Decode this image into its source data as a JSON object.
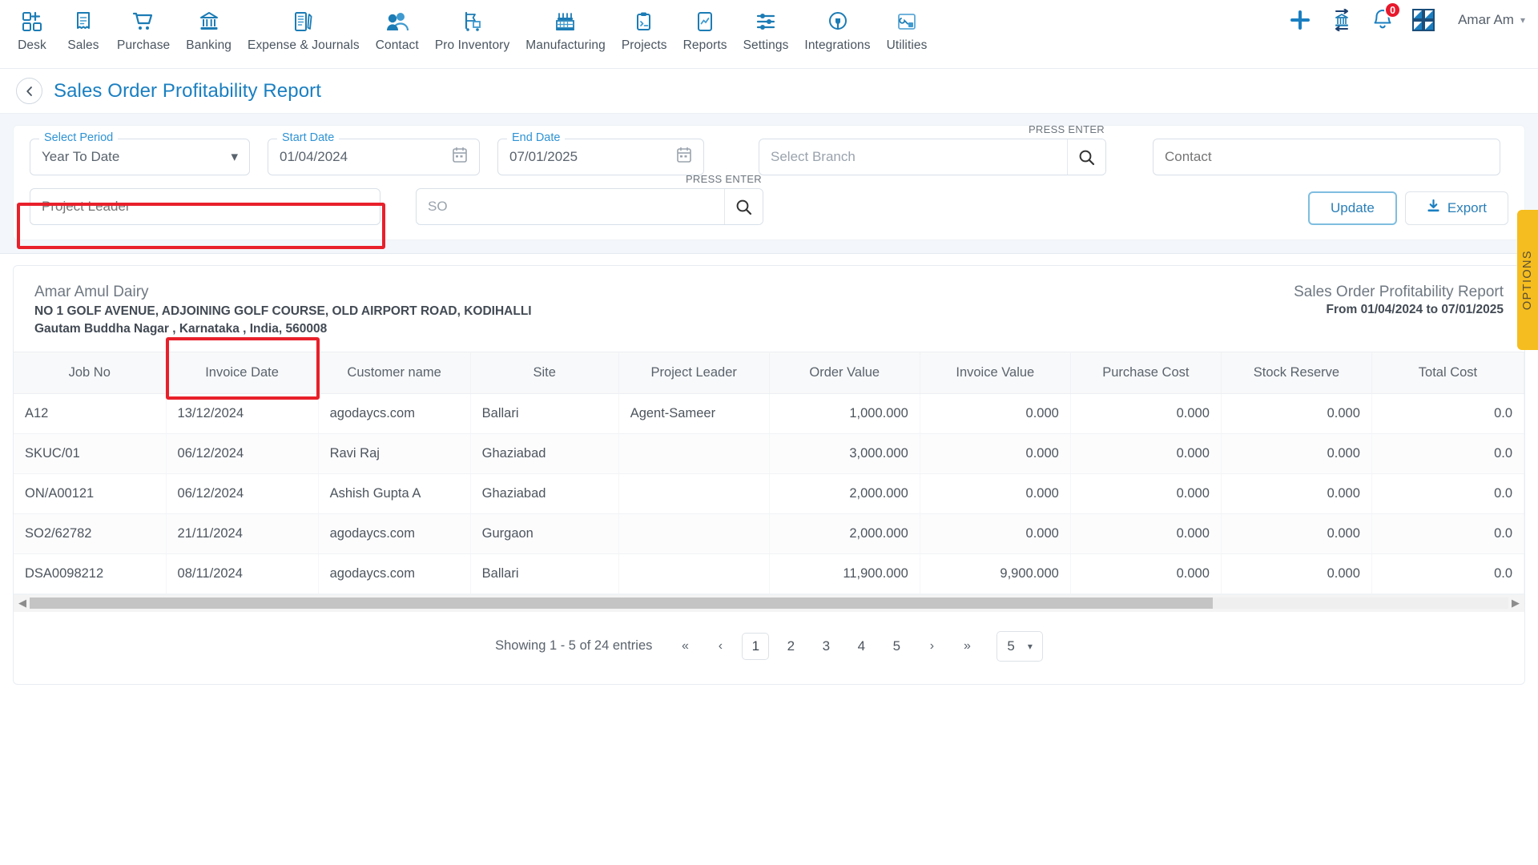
{
  "nav": {
    "items": [
      {
        "label": "Desk",
        "icon": "desk-icon"
      },
      {
        "label": "Sales",
        "icon": "sales-receipt-icon"
      },
      {
        "label": "Purchase",
        "icon": "cart-icon"
      },
      {
        "label": "Banking",
        "icon": "bank-icon"
      },
      {
        "label": "Expense & Journals",
        "icon": "journal-icon"
      },
      {
        "label": "Contact",
        "icon": "people-icon"
      },
      {
        "label": "Pro Inventory",
        "icon": "inventory-icon"
      },
      {
        "label": "Manufacturing",
        "icon": "factory-icon"
      },
      {
        "label": "Projects",
        "icon": "projects-icon"
      },
      {
        "label": "Reports",
        "icon": "reports-chart-icon"
      },
      {
        "label": "Settings",
        "icon": "sliders-icon"
      },
      {
        "label": "Integrations",
        "icon": "plug-icon"
      },
      {
        "label": "Utilities",
        "icon": "utilities-icon"
      }
    ],
    "right": {
      "add_icon": "plus-icon",
      "bank_transfer_icon": "bank-transfer-icon",
      "notification_icon": "bell-icon",
      "notification_count": "0",
      "apps_icon": "grid-apps-icon",
      "user_name": "Amar Am",
      "user_caret_icon": "chevron-down-icon"
    }
  },
  "page": {
    "back_icon": "chevron-left-icon",
    "title": "Sales Order Profitability Report"
  },
  "filters": {
    "period": {
      "legend": "Select Period",
      "value": "Year To Date",
      "caret": "chevron-down-icon"
    },
    "start_date": {
      "legend": "Start Date",
      "value": "01/04/2024",
      "icon": "calendar-icon"
    },
    "end_date": {
      "legend": "End Date",
      "value": "07/01/2025",
      "icon": "calendar-icon"
    },
    "branch": {
      "placeholder": "Select Branch",
      "hint": "PRESS ENTER",
      "icon": "search-icon"
    },
    "contact": {
      "placeholder": "Contact"
    },
    "project_leader": {
      "placeholder": "Project Leader"
    },
    "so": {
      "placeholder": "SO",
      "hint": "PRESS ENTER",
      "icon": "search-icon"
    },
    "update_label": "Update",
    "export_label": "Export",
    "export_icon": "download-icon",
    "highlight_color": "#e8202a"
  },
  "options_tab": {
    "label": "OPTIONS",
    "color": "#f5bd1f"
  },
  "report": {
    "company_name": "Amar Amul Dairy",
    "address_line1": "NO 1 GOLF AVENUE, ADJOINING GOLF COURSE, OLD AIRPORT ROAD, KODIHALLI",
    "address_line2": "Gautam Buddha Nagar , Karnataka , India, 560008",
    "title": "Sales Order Profitability Report",
    "date_range": "From 01/04/2024 to 07/01/2025",
    "columns": [
      {
        "label": "Job No",
        "align": "txt"
      },
      {
        "label": "Invoice Date",
        "align": "txt"
      },
      {
        "label": "Customer name",
        "align": "txt"
      },
      {
        "label": "Site",
        "align": "txt"
      },
      {
        "label": "Project Leader",
        "align": "txt"
      },
      {
        "label": "Order Value",
        "align": "num"
      },
      {
        "label": "Invoice Value",
        "align": "num"
      },
      {
        "label": "Purchase Cost",
        "align": "num"
      },
      {
        "label": "Stock Reserve",
        "align": "num"
      },
      {
        "label": "Total Cost",
        "align": "num"
      }
    ],
    "rows": [
      {
        "job_no": "A12",
        "invoice_date": "13/12/2024",
        "customer": "agodaycs.com",
        "site": "Ballari",
        "project_leader": "Agent-Sameer",
        "order_value": "1,000.000",
        "invoice_value": "0.000",
        "purchase_cost": "0.000",
        "stock_reserve": "0.000",
        "total_cost": "0.0"
      },
      {
        "job_no": "SKUC/01",
        "invoice_date": "06/12/2024",
        "customer": "Ravi Raj",
        "site": "Ghaziabad",
        "project_leader": "",
        "order_value": "3,000.000",
        "invoice_value": "0.000",
        "purchase_cost": "0.000",
        "stock_reserve": "0.000",
        "total_cost": "0.0"
      },
      {
        "job_no": "ON/A00121",
        "invoice_date": "06/12/2024",
        "customer": "Ashish Gupta A",
        "site": "Ghaziabad",
        "project_leader": "",
        "order_value": "2,000.000",
        "invoice_value": "0.000",
        "purchase_cost": "0.000",
        "stock_reserve": "0.000",
        "total_cost": "0.0"
      },
      {
        "job_no": "SO2/62782",
        "invoice_date": "21/11/2024",
        "customer": "agodaycs.com",
        "site": "Gurgaon",
        "project_leader": "",
        "order_value": "2,000.000",
        "invoice_value": "0.000",
        "purchase_cost": "0.000",
        "stock_reserve": "0.000",
        "total_cost": "0.0"
      },
      {
        "job_no": "DSA0098212",
        "invoice_date": "08/11/2024",
        "customer": "agodaycs.com",
        "site": "Ballari",
        "project_leader": "",
        "order_value": "11,900.000",
        "invoice_value": "9,900.000",
        "purchase_cost": "0.000",
        "stock_reserve": "0.000",
        "total_cost": "0.0"
      }
    ],
    "scrollbar": {
      "left_arrow": "caret-left-icon",
      "right_arrow": "caret-right-icon",
      "thumb_pct": "80%"
    }
  },
  "pagination": {
    "showing": "Showing 1 - 5 of 24 entries",
    "first_icon": "double-chevron-left-icon",
    "prev_icon": "chevron-left-icon",
    "pages": [
      "1",
      "2",
      "3",
      "4",
      "5"
    ],
    "active_page": "1",
    "next_icon": "chevron-right-icon",
    "last_icon": "double-chevron-right-icon",
    "page_size": "5",
    "page_size_caret": "chevron-down-icon"
  }
}
